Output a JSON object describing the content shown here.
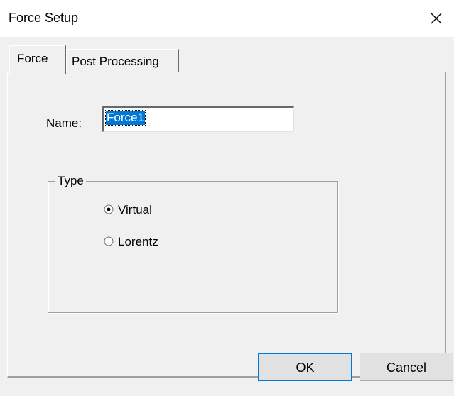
{
  "window": {
    "title": "Force Setup",
    "close_icon": "close-icon"
  },
  "tabs": [
    {
      "label": "Force",
      "selected": true
    },
    {
      "label": "Post Processing",
      "selected": false
    }
  ],
  "form": {
    "name_label": "Name:",
    "name_value": "Force1",
    "type_group": {
      "legend": "Type",
      "options": [
        {
          "label": "Virtual",
          "checked": true
        },
        {
          "label": "Lorentz",
          "checked": false
        }
      ]
    }
  },
  "buttons": {
    "ok": "OK",
    "cancel": "Cancel"
  },
  "colors": {
    "selection": "#0078d7",
    "dialog_bg": "#f0f0f0",
    "button_bg": "#e1e1e1"
  }
}
